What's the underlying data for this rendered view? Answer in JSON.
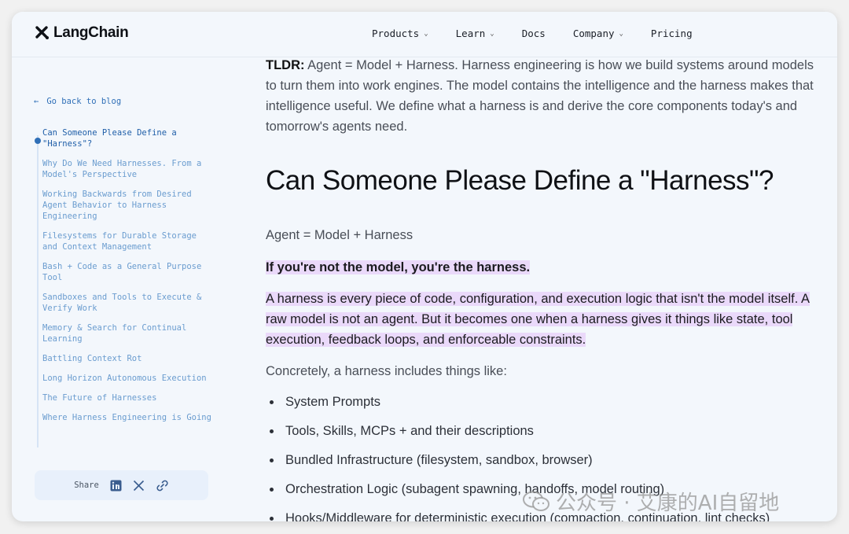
{
  "header": {
    "logo_text": "LangChain",
    "nav": [
      {
        "label": "Products",
        "dropdown": true
      },
      {
        "label": "Learn",
        "dropdown": true
      },
      {
        "label": "Docs",
        "dropdown": false
      },
      {
        "label": "Company",
        "dropdown": true
      },
      {
        "label": "Pricing",
        "dropdown": false
      }
    ]
  },
  "sidebar": {
    "back_label": "Go back to blog",
    "toc": [
      "Can Someone Please Define a \"Harness\"?",
      "Why Do We Need Harnesses. From a Model's Perspective",
      "Working Backwards from Desired Agent Behavior to Harness Engineering",
      "Filesystems for Durable Storage and Context Management",
      "Bash + Code as a General Purpose Tool",
      "Sandboxes and Tools to Execute & Verify Work",
      "Memory & Search for Continual Learning",
      "Battling Context Rot",
      "Long Horizon Autonomous Execution",
      "The Future of Harnesses",
      "Where Harness Engineering is Going"
    ],
    "share_label": "Share",
    "share_icons": [
      "linkedin-icon",
      "x-icon",
      "link-icon"
    ]
  },
  "article": {
    "tldr_label": "TLDR:",
    "tldr_text": " Agent = Model + Harness.  Harness engineering is how we build systems around models to turn them into work engines.  The model contains the intelligence and the harness makes that intelligence useful. We define what a harness is and derive the core components today's and tomorrow's agents need.",
    "heading": "Can Someone Please Define a \"Harness\"?",
    "equation": "Agent = Model + Harness",
    "highlight_bold": "If you're not the model, you're the harness.",
    "highlight_para": "A harness is every piece of code, configuration, and execution logic that isn't the model itself.  A raw model is not an agent. But it becomes one when a harness gives it things like state, tool execution, feedback loops, and enforceable constraints.",
    "intro": "Concretely, a harness includes things like:",
    "bullets": [
      "System Prompts",
      "Tools, Skills, MCPs + and their descriptions",
      "Bundled Infrastructure (filesystem, sandbox, browser)",
      "Orchestration Logic (subagent spawning, handoffs, model routing)",
      "Hooks/Middleware for deterministic execution (compaction, continuation, lint checks)"
    ]
  },
  "watermark": "公众号 · 艾康的AI自留地",
  "colors": {
    "accent": "#2f6fb7",
    "highlight": "#ead9fa",
    "background": "#f3f7fc"
  }
}
